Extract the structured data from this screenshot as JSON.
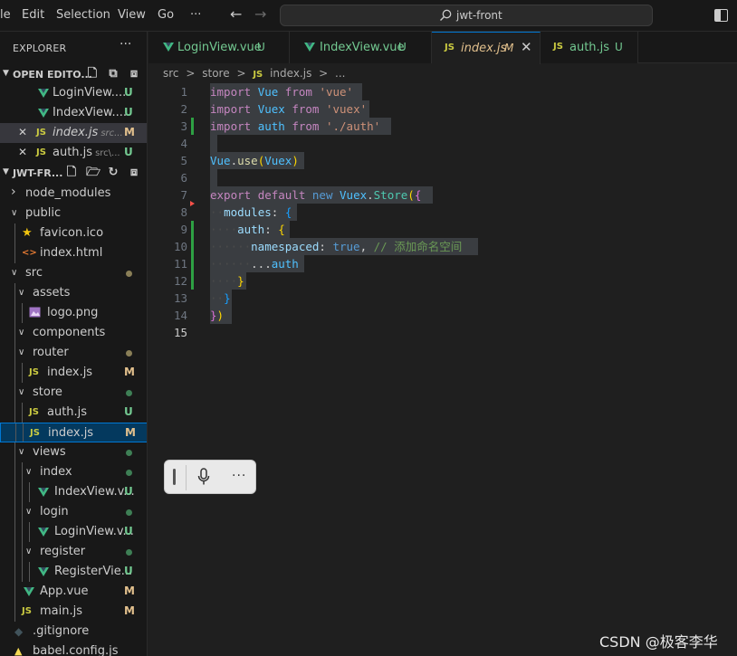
{
  "menu": {
    "items": [
      "le",
      "Edit",
      "Selection",
      "View",
      "Go",
      "···"
    ],
    "back_icon": "arrow-left-icon",
    "forward_icon": "arrow-right-icon"
  },
  "command_center": {
    "text": "jwt-front",
    "icon": "search-icon"
  },
  "explorer": {
    "title": "EXPLORER",
    "more": "···",
    "open_editors": {
      "label": "OPEN EDITO...",
      "items": [
        {
          "name": "LoginView....",
          "desc": "",
          "icon": "vue",
          "badge": "U",
          "close": ""
        },
        {
          "name": "IndexView....",
          "desc": "",
          "icon": "vue",
          "badge": "U",
          "close": ""
        },
        {
          "name": "index.js",
          "desc": "src...",
          "icon": "JS",
          "badge": "M",
          "close": "✕"
        },
        {
          "name": "auth.js",
          "desc": "src\\...",
          "icon": "JS",
          "badge": "U",
          "close": "✕"
        }
      ]
    },
    "project": {
      "label": "JWT-FR...",
      "tree": [
        {
          "name": "node_modules",
          "type": "folder",
          "open": false,
          "depth": 0,
          "badge": "",
          "dot": ""
        },
        {
          "name": "public",
          "type": "folder",
          "open": true,
          "depth": 0,
          "badge": "",
          "dot": ""
        },
        {
          "name": "favicon.ico",
          "type": "fav",
          "depth": 1,
          "badge": "",
          "dot": ""
        },
        {
          "name": "index.html",
          "type": "html",
          "depth": 1,
          "badge": "",
          "dot": ""
        },
        {
          "name": "src",
          "type": "folder",
          "open": true,
          "depth": 0,
          "badge": "",
          "dot": "#8a7f57"
        },
        {
          "name": "assets",
          "type": "folder",
          "open": true,
          "depth": 1,
          "badge": "",
          "dot": ""
        },
        {
          "name": "logo.png",
          "type": "img",
          "depth": 2,
          "badge": "",
          "dot": ""
        },
        {
          "name": "components",
          "type": "folder",
          "open": true,
          "depth": 1,
          "badge": "",
          "dot": ""
        },
        {
          "name": "router",
          "type": "folder",
          "open": true,
          "depth": 1,
          "badge": "",
          "dot": "#8a7f57"
        },
        {
          "name": "index.js",
          "type": "js",
          "depth": 2,
          "badge": "M",
          "dot": ""
        },
        {
          "name": "store",
          "type": "folder",
          "open": true,
          "depth": 1,
          "badge": "",
          "dot": "#3e7f55"
        },
        {
          "name": "auth.js",
          "type": "js",
          "depth": 2,
          "badge": "U",
          "dot": ""
        },
        {
          "name": "index.js",
          "type": "js",
          "depth": 2,
          "badge": "M",
          "dot": "",
          "selected": true
        },
        {
          "name": "views",
          "type": "folder",
          "open": true,
          "depth": 1,
          "badge": "",
          "dot": "#3e7f55"
        },
        {
          "name": "index",
          "type": "folder",
          "open": true,
          "depth": 2,
          "badge": "",
          "dot": "#3e7f55"
        },
        {
          "name": "IndexView.v...",
          "type": "vue",
          "depth": 3,
          "badge": "U",
          "dot": ""
        },
        {
          "name": "login",
          "type": "folder",
          "open": true,
          "depth": 2,
          "badge": "",
          "dot": "#3e7f55"
        },
        {
          "name": "LoginView.v...",
          "type": "vue",
          "depth": 3,
          "badge": "U",
          "dot": ""
        },
        {
          "name": "register",
          "type": "folder",
          "open": true,
          "depth": 2,
          "badge": "",
          "dot": "#3e7f55"
        },
        {
          "name": "RegisterVie...",
          "type": "vue",
          "depth": 3,
          "badge": "U",
          "dot": ""
        },
        {
          "name": "App.vue",
          "type": "vue",
          "depth": 1,
          "badge": "M",
          "dot": ""
        },
        {
          "name": "main.js",
          "type": "js",
          "depth": 1,
          "badge": "M",
          "dot": ""
        },
        {
          "name": ".gitignore",
          "type": "git",
          "depth": 0,
          "badge": "",
          "dot": ""
        },
        {
          "name": "babel.config.js",
          "type": "babel",
          "depth": 0,
          "badge": "",
          "dot": ""
        }
      ]
    }
  },
  "tabs": [
    {
      "label": "LoginView.vue",
      "badge": "U",
      "icon": "vue",
      "active": false
    },
    {
      "label": "IndexView.vue",
      "badge": "U",
      "icon": "vue",
      "active": false
    },
    {
      "label": "index.js",
      "badge": "M",
      "icon": "JS",
      "active": true,
      "close": "✕"
    },
    {
      "label": "auth.js",
      "badge": "U",
      "icon": "JS",
      "active": false
    }
  ],
  "breadcrumb": [
    "src",
    ">",
    "store",
    ">",
    "JS",
    "index.js",
    ">",
    "..."
  ],
  "editor": {
    "lines": [
      [
        [
          "tk-kw",
          "import"
        ],
        [
          "tk-plain",
          " "
        ],
        [
          "tk-var",
          "Vue"
        ],
        [
          "tk-plain",
          " "
        ],
        [
          "tk-kw",
          "from"
        ],
        [
          "tk-plain",
          " "
        ],
        [
          "tk-str",
          "'vue'"
        ]
      ],
      [
        [
          "tk-kw",
          "import"
        ],
        [
          "tk-plain",
          " "
        ],
        [
          "tk-var",
          "Vuex"
        ],
        [
          "tk-plain",
          " "
        ],
        [
          "tk-kw",
          "from"
        ],
        [
          "tk-plain",
          " "
        ],
        [
          "tk-str",
          "'vuex'"
        ]
      ],
      [
        [
          "tk-kw",
          "import"
        ],
        [
          "tk-plain",
          " "
        ],
        [
          "tk-var",
          "auth"
        ],
        [
          "tk-plain",
          " "
        ],
        [
          "tk-kw",
          "from"
        ],
        [
          "tk-plain",
          " "
        ],
        [
          "tk-str",
          "'./auth'"
        ]
      ],
      [],
      [
        [
          "tk-var",
          "Vue"
        ],
        [
          "tk-plain",
          "."
        ],
        [
          "tk-fn",
          "use"
        ],
        [
          "tk-br1",
          "("
        ],
        [
          "tk-var",
          "Vuex"
        ],
        [
          "tk-br1",
          ")"
        ]
      ],
      [],
      [
        [
          "tk-kw",
          "export"
        ],
        [
          "tk-plain",
          " "
        ],
        [
          "tk-kw",
          "default"
        ],
        [
          "tk-plain",
          " "
        ],
        [
          "tk-kw2",
          "new"
        ],
        [
          "tk-plain",
          " "
        ],
        [
          "tk-var",
          "Vuex"
        ],
        [
          "tk-plain",
          "."
        ],
        [
          "tk-cls",
          "Store"
        ],
        [
          "tk-br1",
          "("
        ],
        [
          "tk-br2",
          "{"
        ]
      ],
      [
        [
          "tk-ws",
          "··"
        ],
        [
          "tk-id",
          "modules"
        ],
        [
          "tk-plain",
          ": "
        ],
        [
          "tk-br3",
          "{"
        ]
      ],
      [
        [
          "tk-ws",
          "····"
        ],
        [
          "tk-id",
          "auth"
        ],
        [
          "tk-plain",
          ": "
        ],
        [
          "tk-br1",
          "{"
        ]
      ],
      [
        [
          "tk-ws",
          "······"
        ],
        [
          "tk-id",
          "namespaced"
        ],
        [
          "tk-plain",
          ": "
        ],
        [
          "tk-kw2",
          "true"
        ],
        [
          "tk-plain",
          ", "
        ],
        [
          "tk-cm",
          "// 添加命名空间"
        ]
      ],
      [
        [
          "tk-ws",
          "······"
        ],
        [
          "tk-plain",
          "..."
        ],
        [
          "tk-var",
          "auth"
        ]
      ],
      [
        [
          "tk-ws",
          "····"
        ],
        [
          "tk-br1",
          "}"
        ]
      ],
      [
        [
          "tk-ws",
          "··"
        ],
        [
          "tk-br3",
          "}"
        ]
      ],
      [
        [
          "tk-br2",
          "}"
        ],
        [
          "tk-br1",
          ")"
        ]
      ],
      []
    ]
  },
  "dictation_toolbar": {
    "mic_icon": "microphone-icon",
    "more": "···"
  },
  "watermark": "CSDN @极客李华"
}
